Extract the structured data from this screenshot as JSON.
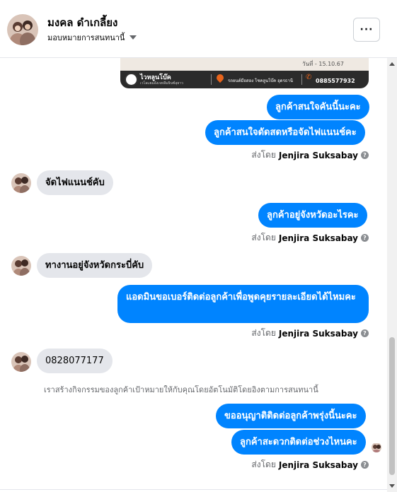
{
  "header": {
    "contact_name": "มงคล ดำเกลี้ยง",
    "assign_label": "มอบหมายการสนทนานี้",
    "more_label": "···"
  },
  "banner": {
    "date_text": "วันที่ - 15.10.67",
    "brand": "ไวหลูนโบ๊ค",
    "brand_sub": "เวโลแยมอังเจหลีมธินซ์ลุยาว",
    "address": "รถยนต์มือสอง โชคลูนโบ๊ค อุดรธานี",
    "phone": "0885577932"
  },
  "messages": [
    {
      "dir": "out",
      "text": "ลูกค้าสนใจคันนี้นะคะ"
    },
    {
      "dir": "out",
      "text": "ลูกค้าสนใจดัดสดหรือจัดไฟแนนช์คะ"
    },
    {
      "dir": "in",
      "text": "จัดไฟแนนช์คับ"
    },
    {
      "dir": "out",
      "text": "ลูกค้าอยู่จังหวัดอะไรคะ"
    },
    {
      "dir": "in",
      "text": "ทางานอยู่จังหวัดกระบี่คับ"
    },
    {
      "dir": "out",
      "text": "แอดมินขอเบอร์ติดต่อลูกค้าเพื่อพูดคุยรายละเอียดได้ไหมคะ"
    },
    {
      "dir": "in",
      "text": "0828077177"
    },
    {
      "dir": "out",
      "text": "ขออนุญาติติดต่อลูกค้าพรุ่งนี้นะคะ"
    },
    {
      "dir": "out",
      "text": "ลูกค้าสะดวกติดต่อช่วงไหนคะ"
    }
  ],
  "sent_by": {
    "prefix": "ส่งโดย",
    "sender": "Jenjira Suksabay",
    "help": "?"
  },
  "ai_note": "เราสร้างกิจกรรมของลูกค้าเป้าหมายให้กับคุณโดยอัตโนมัติโดยอิงตามการสนทนานี้",
  "colors": {
    "outgoing_bubble": "#0084ff",
    "incoming_bubble": "#e4e6eb",
    "meta_text": "#65676b"
  }
}
